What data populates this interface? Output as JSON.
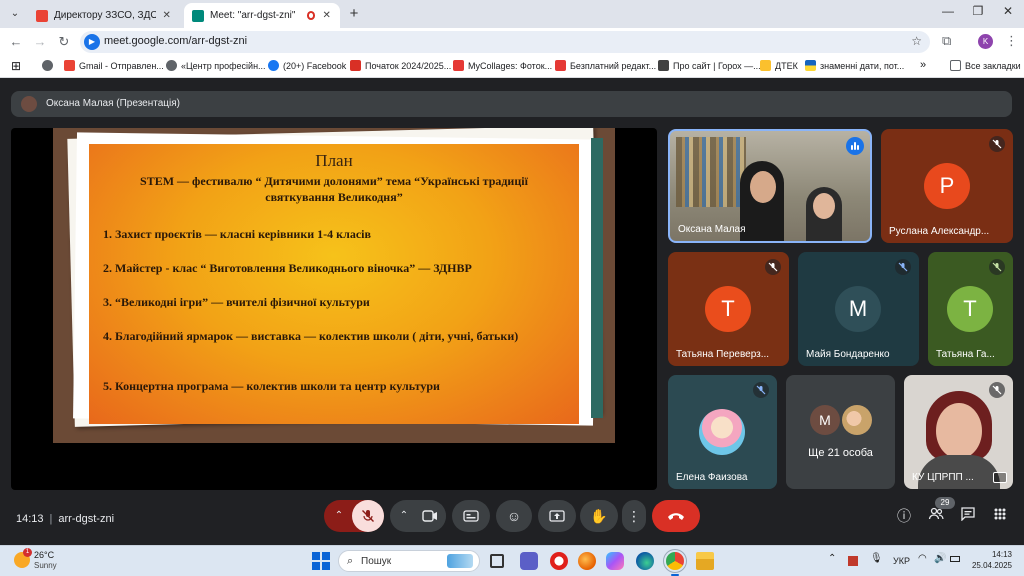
{
  "browser": {
    "tabs": [
      {
        "title": "Директору ЗЗСО, ЗДО. Запро",
        "favicon_color": "#ea4335",
        "active": false
      },
      {
        "title": "Meet: \"arr-dgst-zni\"",
        "favicon_color": "#00897b",
        "active": true
      }
    ],
    "url": "meet.google.com/arr-dgst-zni",
    "profile_initial": "K",
    "bookmarks": [
      {
        "label": "Gmail - Отправлен...",
        "color": "#ea4335"
      },
      {
        "label": "«Центр професійн...",
        "color": "#5f6368"
      },
      {
        "label": "(20+) Facebook",
        "color": "#1877f2"
      },
      {
        "label": "Початок 2024/2025...",
        "color": "#d93025"
      },
      {
        "label": "MyCollages: Фоток...",
        "color": "#e53935"
      },
      {
        "label": "Безплатний редакт...",
        "color": "#e53935"
      },
      {
        "label": "Про сайт | Горох —...",
        "color": "#424242"
      },
      {
        "label": "ДТЕК",
        "color": "#fbc02d"
      },
      {
        "label": "знаменні дати, пот...",
        "color": "#1565c0"
      }
    ],
    "bookmarks_all": "Все закладки"
  },
  "meet": {
    "presentation_title": "Оксана Малая (Презентація)",
    "slide": {
      "title": "План",
      "subtitle": "STEM — фестивалю “ Дитячими долонями” тема “Українські традиції святкування Великодня”",
      "items": [
        "1. Захист проєктів — класні керівники 1-4 класів",
        "2. Майстер - клас “ Виготовлення Великоднього віночка” — ЗДНВР",
        "3. “Великодні ігри” — вчителі фізичної культури",
        "4. Благодійний ярмарок — виставка — колектив школи ( діти, учні, батьки)",
        "5. Концертна програма — колектив школи та центр культури"
      ]
    },
    "participants": [
      {
        "name": "Оксана Малая",
        "initial": "",
        "bg": "#9e9a8e",
        "status": "speaking"
      },
      {
        "name": "Руслана Александр...",
        "initial": "Р",
        "avatar_color": "#e8491d",
        "bg": "#7a2e14",
        "status": "muted"
      },
      {
        "name": "Татьяна Переверз...",
        "initial": "Т",
        "avatar_color": "#ea4d1c",
        "bg": "#7a3014",
        "status": "muted"
      },
      {
        "name": "Майя Бондаренко",
        "initial": "М",
        "avatar_color": "#2f4f58",
        "bg": "#1f3a42",
        "status": "muted"
      },
      {
        "name": "Татьяна Га...",
        "initial": "Т",
        "avatar_color": "#7cb342",
        "bg": "#3b5a22",
        "status": "muted"
      },
      {
        "name": "Елена Фаизова",
        "initial": "",
        "avatar_color": "#f4a6c0",
        "bg": "#2c4a52",
        "status": "muted"
      },
      {
        "name": "Ще 21 особа",
        "initial": "М",
        "avatar_color": "#6d4c41",
        "bg": "#3c4043",
        "status": ""
      },
      {
        "name": "КУ ЦПРПП ...",
        "initial": "",
        "bg": "#d9d5d0",
        "status": "muted"
      }
    ],
    "time": "14:13",
    "meeting_code": "arr-dgst-zni",
    "participant_count": "29"
  },
  "taskbar": {
    "temperature": "26°C",
    "condition": "Sunny",
    "weather_badge": "1",
    "search_placeholder": "Пошук",
    "language": "УКР",
    "clock_time": "14:13",
    "clock_date": "25.04.2025"
  }
}
